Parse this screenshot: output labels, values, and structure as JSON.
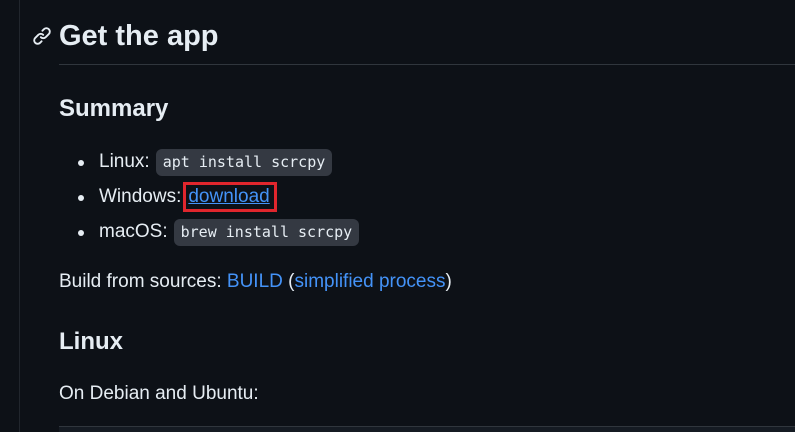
{
  "header": {
    "title": "Get the app"
  },
  "summary": {
    "heading": "Summary",
    "items": [
      {
        "label": "Linux:",
        "code": "apt install scrcpy"
      },
      {
        "label": "Windows:",
        "link": "download"
      },
      {
        "label": "macOS:",
        "code": "brew install scrcpy"
      }
    ]
  },
  "build": {
    "prefix": "Build from sources:",
    "link1": "BUILD",
    "open_paren": "(",
    "link2": "simplified process",
    "close_paren": ")"
  },
  "linux": {
    "heading": "Linux",
    "intro": "On Debian and Ubuntu:"
  },
  "colors": {
    "background": "#0d1117",
    "text": "#e6edf3",
    "link": "#4493f8",
    "highlight_box": "#e0262d",
    "code_bg": "#343942"
  },
  "icons": {
    "anchor": "link-icon"
  }
}
